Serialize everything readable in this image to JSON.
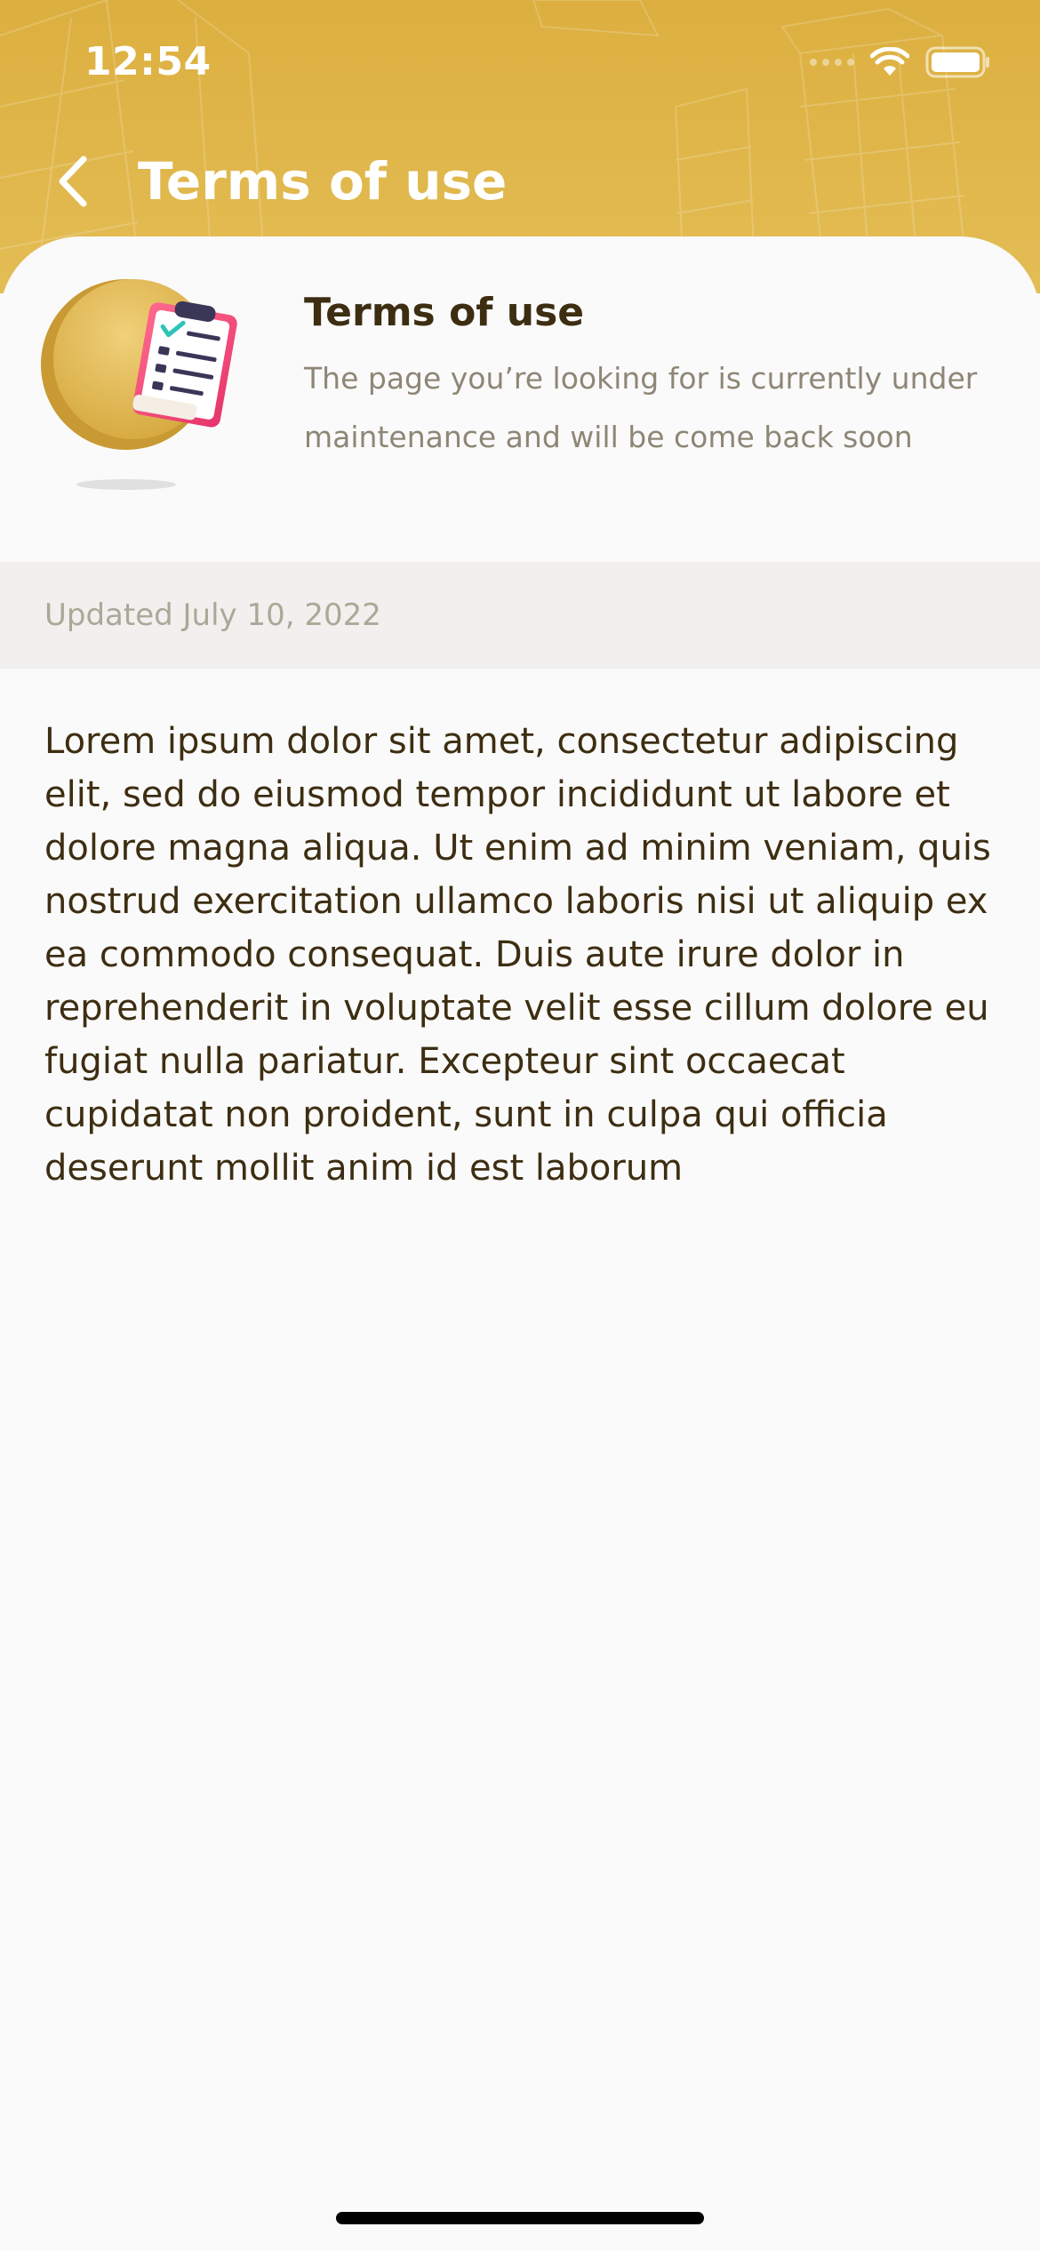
{
  "colors": {
    "header_gold": "#dcaf3f",
    "title_text": "#3d2e12",
    "muted_text": "#8e8676",
    "updated_bar": "#f1f0ee",
    "background": "#fafafa"
  },
  "status_bar": {
    "time": "12:54",
    "icons": [
      "signal-icon",
      "wifi-icon",
      "battery-icon"
    ]
  },
  "header": {
    "back_icon": "chevron-left-icon",
    "title": "Terms of use"
  },
  "hero": {
    "icon": "clipboard-checklist-icon",
    "title": "Terms of use",
    "description": "The page you’re looking for is currently under maintenance and will be come back soon"
  },
  "updated": {
    "text": "Updated July 10, 2022"
  },
  "content": {
    "body": "Lorem ipsum dolor sit amet, consectetur adipiscing elit, sed do eiusmod tempor incididunt ut labore et dolore magna aliqua. Ut enim ad minim veniam, quis nostrud exercitation ullamco laboris nisi ut aliquip ex ea commodo consequat. Duis aute irure dolor in reprehenderit in voluptate velit esse cillum dolore eu fugiat nulla pariatur. Excepteur sint occaecat cupidatat non proident, sunt in culpa qui officia deserunt mollit anim id est laborum"
  }
}
